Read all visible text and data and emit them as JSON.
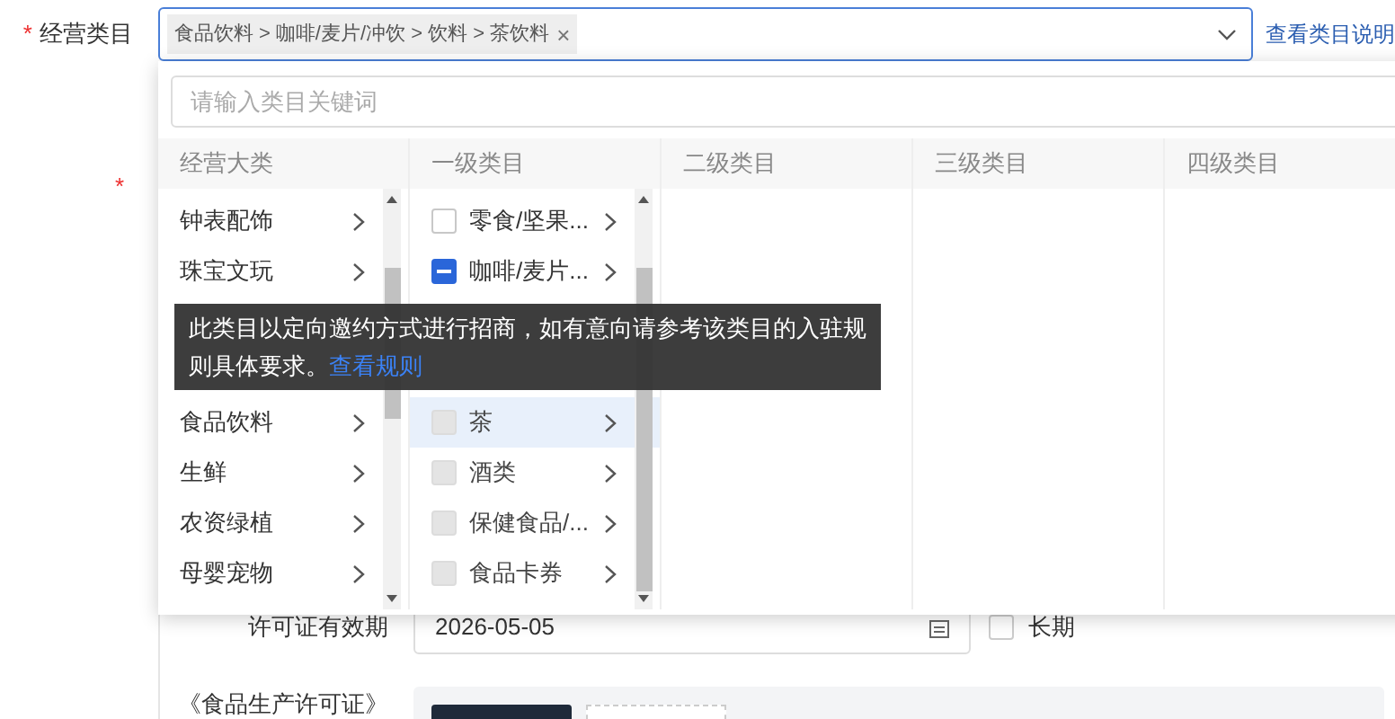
{
  "category_field": {
    "required_mark": "*",
    "label": "经营类目",
    "tag": "食品饮料 > 咖啡/麦片/冲饮 > 饮料 > 茶饮料",
    "remove": "×",
    "help_link": "查看类目说明"
  },
  "hidden_field": {
    "required_mark": "*"
  },
  "dropdown": {
    "search_placeholder": "请输入类目关键词",
    "columns": [
      {
        "title": "经营大类"
      },
      {
        "title": "一级类目"
      },
      {
        "title": "二级类目"
      },
      {
        "title": "三级类目"
      },
      {
        "title": "四级类目"
      }
    ],
    "main_categories": [
      {
        "kind": "item",
        "label": "钟表配饰",
        "selected": false
      },
      {
        "kind": "item",
        "label": "珠宝文玩",
        "selected": false
      },
      {
        "kind": "hidden"
      },
      {
        "kind": "hidden"
      },
      {
        "kind": "item",
        "label": "食品饮料",
        "selected": false
      },
      {
        "kind": "item",
        "label": "生鲜",
        "selected": false
      },
      {
        "kind": "item",
        "label": "农资绿植",
        "selected": false
      },
      {
        "kind": "item",
        "label": "母婴宠物",
        "selected": false
      }
    ],
    "level1_categories": [
      {
        "kind": "item",
        "label": "零食/坚果...",
        "indeterminate": false,
        "disabled": false,
        "selected": false
      },
      {
        "kind": "item",
        "label": "咖啡/麦片...",
        "indeterminate": true,
        "disabled": false,
        "selected": false
      },
      {
        "kind": "hidden"
      },
      {
        "kind": "hidden"
      },
      {
        "kind": "item",
        "label": "茶",
        "indeterminate": false,
        "disabled": true,
        "selected": true
      },
      {
        "kind": "item",
        "label": "酒类",
        "indeterminate": false,
        "disabled": true,
        "selected": false
      },
      {
        "kind": "item",
        "label": "保健食品/...",
        "indeterminate": false,
        "disabled": true,
        "selected": false
      },
      {
        "kind": "item",
        "label": "食品卡券",
        "indeterminate": false,
        "disabled": true,
        "selected": false
      }
    ],
    "tooltip": "此类目以定向邀约方式进行招商，如有意向请参考该类目的入驻规则具体要求。",
    "tooltip_link": "查看规则"
  },
  "license_field": {
    "label": "许可证有效期",
    "value": "2026-05-05",
    "long_term_label": "长期",
    "long_term": false
  },
  "upload_field": {
    "label": "《食品生产许可证》"
  }
}
